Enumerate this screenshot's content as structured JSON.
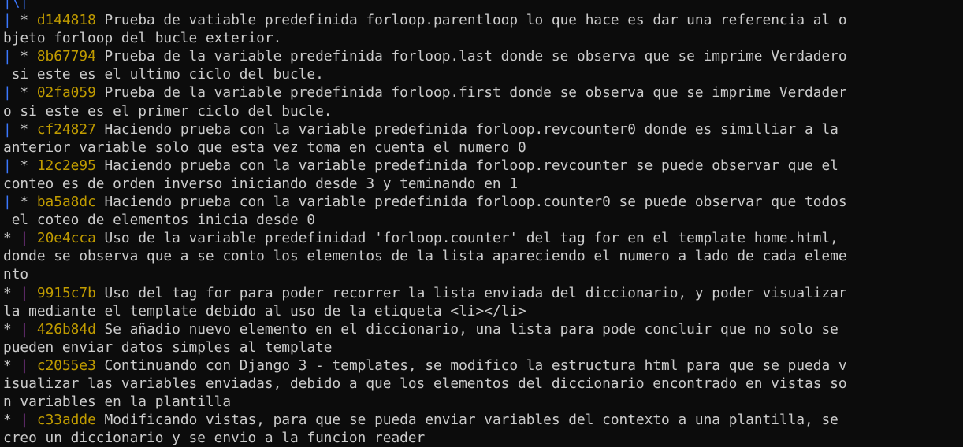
{
  "terminal": {
    "top_graph": "|\\|",
    "commits": [
      {
        "graph": "|",
        "graph_color": "blue",
        "hash": "d144818",
        "lines": [
          "Prueba de vatiable predefinida forloop.parentloop lo que hace es dar una referencia al o",
          "bjeto forloop del bucle exterior."
        ]
      },
      {
        "graph": "|",
        "graph_color": "blue",
        "hash": "8b67794",
        "lines": [
          "Prueba de la variable predefinida forloop.last donde se observa que se imprime Verdadero",
          " si este es el ultimo ciclo del bucle."
        ]
      },
      {
        "graph": "|",
        "graph_color": "blue",
        "hash": "02fa059",
        "lines": [
          "Prueba de la variable predefinida forloop.first donde se observa que se imprime Verdader",
          "o si este es el primer ciclo del bucle."
        ]
      },
      {
        "graph": "|",
        "graph_color": "blue",
        "hash": "cf24827",
        "lines": [
          "Haciendo prueba con la variable predefinida forloop.revcounter0 donde es simılliar a la",
          "anterior variable solo que esta vez toma en cuenta el numero 0"
        ]
      },
      {
        "graph": "|",
        "graph_color": "blue",
        "hash": "12c2e95",
        "lines": [
          "Haciendo prueba con la variable predefinida forloop.revcounter se puede observar que el",
          "conteo es de orden inverso iniciando desde 3 y teminando en 1"
        ]
      },
      {
        "graph": "|",
        "graph_color": "blue",
        "hash": "ba5a8dc",
        "lines": [
          "Haciendo prueba con la variable predefinida forloop.counter0 se puede observar que todos",
          " el coteo de elementos inicia desde 0"
        ]
      },
      {
        "graph": "|",
        "graph_color": "magenta",
        "star_first": true,
        "hash": "20e4cca",
        "lines": [
          "Uso de la variable predefinidad 'forloop.counter' del tag for en el template home.html,",
          "donde se observa que a se conto los elementos de la lista apareciendo el numero a lado de cada eleme",
          "nto"
        ]
      },
      {
        "graph": "|",
        "graph_color": "magenta",
        "star_first": true,
        "hash": "9915c7b",
        "lines": [
          "Uso del tag for para poder recorrer la lista enviada del diccionario, y poder visualizar",
          "la mediante el template debido al uso de la etiqueta <li></li>"
        ]
      },
      {
        "graph": "|",
        "graph_color": "magenta",
        "star_first": true,
        "hash": "426b84d",
        "lines": [
          "Se añadio nuevo elemento en el diccionario, una lista para pode concluir que no solo se",
          "pueden enviar datos simples al template"
        ]
      },
      {
        "graph": "|",
        "graph_color": "magenta",
        "star_first": true,
        "hash": "c2055e3",
        "lines": [
          "Continuando con Django 3 - templates, se modifico la estructura html para que se pueda v",
          "isualizar las variables enviadas, debido a que los elementos del diccionario encontrado en vistas so",
          "n variables en la plantilla"
        ]
      },
      {
        "graph": "|",
        "graph_color": "magenta",
        "star_first": true,
        "hash": "c33adde",
        "lines": [
          "Modificando vistas, para que se pueda enviar variables del contexto a una plantilla, se",
          "creo un diccionario y se envio a la funcion reader"
        ]
      }
    ],
    "colors": {
      "background": "#0c0c0c",
      "text": "#cccccc",
      "hash": "#c19c00",
      "graph_blue": "#3b78ff",
      "graph_magenta": "#b148c6"
    }
  }
}
